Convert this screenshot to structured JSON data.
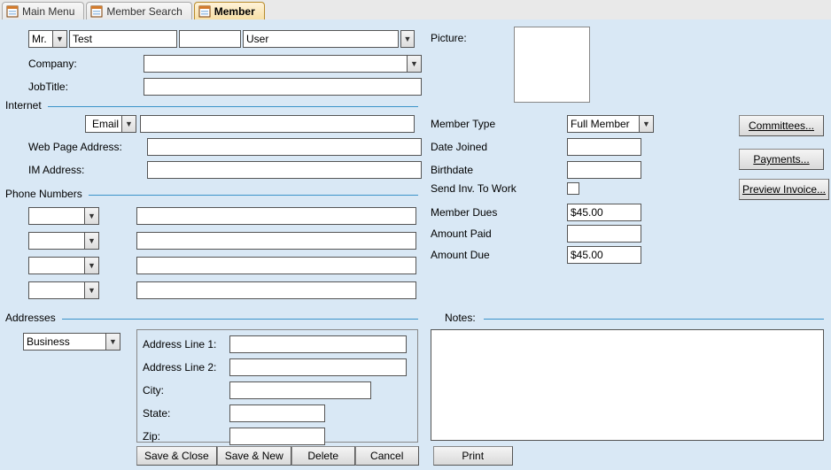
{
  "tabs": {
    "main_menu": "Main Menu",
    "member_search": "Member Search",
    "member": "Member"
  },
  "name": {
    "prefix": "Mr.",
    "first": "Test",
    "middle": "",
    "last": "User"
  },
  "labels": {
    "company": "Company:",
    "jobtitle": "JobTitle:",
    "picture": "Picture:",
    "internet": "Internet",
    "email": "Email",
    "webpage": "Web Page Address:",
    "im": "IM Address:",
    "phone_section": "Phone Numbers",
    "addresses": "Addresses",
    "notes": "Notes:",
    "addr_line1": "Address Line 1:",
    "addr_line2": "Address Line 2:",
    "city": "City:",
    "state": "State:",
    "zip": "Zip:",
    "member_type": "Member Type",
    "date_joined": "Date Joined",
    "birthdate": "Birthdate",
    "send_inv": "Send Inv. To Work",
    "member_dues": "Member Dues",
    "amount_paid": "Amount Paid",
    "amount_due": "Amount Due"
  },
  "values": {
    "company": "",
    "jobtitle": "",
    "email": "",
    "webpage": "",
    "im": "",
    "phone_type1": "",
    "phone1": "",
    "phone_type2": "",
    "phone2": "",
    "phone_type3": "",
    "phone3": "",
    "phone_type4": "",
    "phone4": "",
    "addr_type": "Business",
    "addr_line1": "",
    "addr_line2": "",
    "city": "",
    "state": "",
    "zip": "",
    "member_type": "Full Member",
    "date_joined": "",
    "birthdate": "",
    "member_dues": "$45.00",
    "amount_paid": "",
    "amount_due": "$45.00",
    "notes": ""
  },
  "buttons": {
    "committees": "Committees...",
    "payments": "Payments...",
    "preview_invoice": "Preview Invoice...",
    "save_close": "Save & Close",
    "save_new": "Save & New",
    "delete": "Delete",
    "cancel": "Cancel",
    "print": "Print"
  }
}
